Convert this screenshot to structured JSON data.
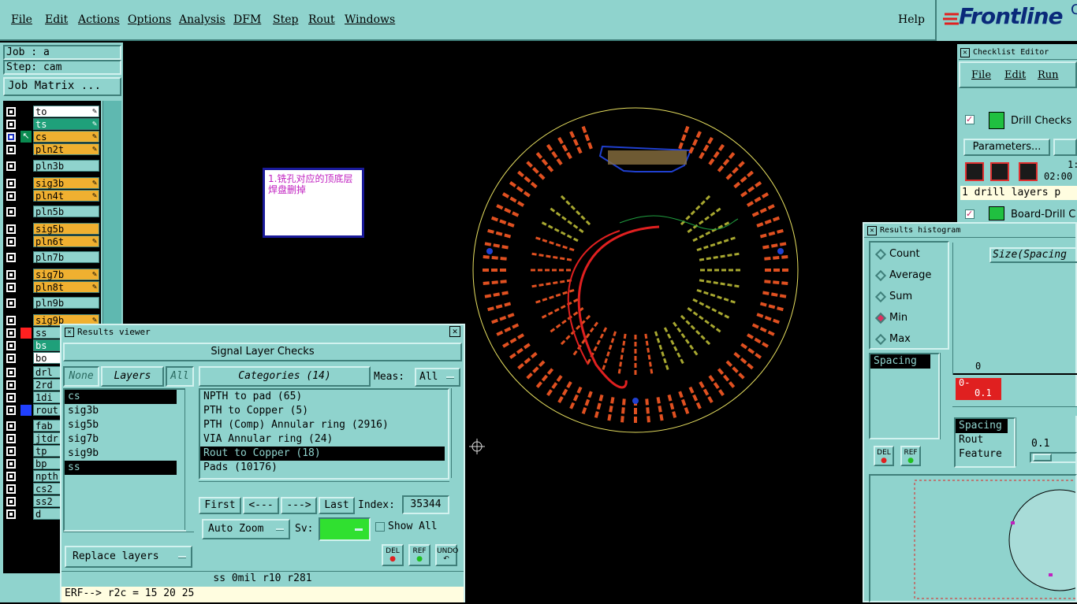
{
  "menubar": {
    "items": [
      "File",
      "Edit",
      "Actions",
      "Options",
      "Analysis",
      "DFM",
      "Step",
      "Rout",
      "Windows"
    ],
    "help": "Help",
    "logo": "Frontline"
  },
  "job": {
    "job_label": "Job : a",
    "step_label": "Step: cam",
    "matrix_button": "Job Matrix ..."
  },
  "layers": [
    {
      "name": "to",
      "color": "#ffffff"
    },
    {
      "name": "ts",
      "color": "#1fa07a"
    },
    {
      "name": "cs",
      "color": "#f0b030"
    },
    {
      "name": "pln2t",
      "color": "#f0b030"
    },
    {
      "name": "pln3b",
      "color": "#8fd3cd"
    },
    {
      "name": "sig3b",
      "color": "#f0b030"
    },
    {
      "name": "pln4t",
      "color": "#f0b030"
    },
    {
      "name": "pln5b",
      "color": "#8fd3cd"
    },
    {
      "name": "sig5b",
      "color": "#f0b030"
    },
    {
      "name": "pln6t",
      "color": "#f0b030"
    },
    {
      "name": "pln7b",
      "color": "#8fd3cd"
    },
    {
      "name": "sig7b",
      "color": "#f0b030"
    },
    {
      "name": "pln8t",
      "color": "#f0b030"
    },
    {
      "name": "pln9b",
      "color": "#8fd3cd"
    },
    {
      "name": "sig9b",
      "color": "#f0b030"
    },
    {
      "name": "ss",
      "color": "#8fd3cd"
    },
    {
      "name": "bs",
      "color": "#1fa07a"
    },
    {
      "name": "bo",
      "color": "#ffffff"
    },
    {
      "name": "drl",
      "color": "#8fd3cd"
    },
    {
      "name": "2rd",
      "color": "#8fd3cd"
    },
    {
      "name": "1di",
      "color": "#8fd3cd"
    },
    {
      "name": "rout",
      "color": "#8fd3cd"
    },
    {
      "name": "fab",
      "color": "#8fd3cd"
    },
    {
      "name": "jtdr",
      "color": "#8fd3cd"
    },
    {
      "name": "tp",
      "color": "#8fd3cd"
    },
    {
      "name": "bp",
      "color": "#8fd3cd"
    },
    {
      "name": "npth",
      "color": "#8fd3cd"
    },
    {
      "name": "cs2",
      "color": "#8fd3cd"
    },
    {
      "name": "ss2",
      "color": "#8fd3cd"
    },
    {
      "name": "d",
      "color": "#8fd3cd"
    }
  ],
  "note": {
    "text": "1.铣孔对应的顶底层焊盘删掉"
  },
  "results_viewer": {
    "title": "Results viewer",
    "header": "Signal Layer Checks",
    "none_btn": "None",
    "layers_btn": "Layers",
    "all_btn": "All",
    "categories_btn": "Categories (14)",
    "meas_label": "Meas:",
    "meas_value": "All",
    "layer_items": [
      "cs",
      "sig3b",
      "sig5b",
      "sig7b",
      "sig9b",
      "ss"
    ],
    "category_items": [
      "NPTH to pad (65)",
      "PTH to Copper (5)",
      "PTH (Comp) Annular ring (2916)",
      "VIA Annular ring (24)",
      "Rout to Copper (18)",
      "Pads (10176)"
    ],
    "first_btn": "First",
    "prev_btn": "<---",
    "next_btn": "--->",
    "last_btn": "Last",
    "index_label": "Index:",
    "index_value": "35344",
    "autozoom_btn": "Auto Zoom",
    "sv_label": "Sv:",
    "show_all_label": "Show All",
    "replace_btn": "Replace layers",
    "del_btn": "DEL",
    "ref_btn": "REF",
    "undo_btn": "UNDO",
    "status_line": "ss 0mil  r10  r281",
    "erf_line": "ERF--> r2c = 15 20 25"
  },
  "checklist": {
    "title": "Checklist Editor",
    "menu": [
      "File",
      "Edit",
      "Run"
    ],
    "drill_checks": "Drill Checks",
    "parameters_btn": "Parameters...",
    "time_1": "1:",
    "time_2": "02:00",
    "drill_layers": "1 drill layers p",
    "board_drill": "Board-Drill C"
  },
  "histogram": {
    "title": "Results histogram",
    "options": [
      "Count",
      "Average",
      "Sum",
      "Min",
      "Max"
    ],
    "selected_option": "Min",
    "size_label": "Size(Spacing",
    "list1": [
      "Spacing"
    ],
    "zero_label": "0",
    "bar_label_top": "0-",
    "bar_label_bottom": "0.1",
    "list2": [
      "Spacing",
      "Rout",
      "Feature"
    ],
    "value": "0.1",
    "del_btn": "DEL",
    "ref_btn": "REF"
  },
  "colors": {
    "panel": "#8fd3cd",
    "accent_red": "#e03030",
    "pad_orange": "#e05020",
    "pad_olive": "#a8a830",
    "outline_yellow": "#e8e060",
    "blue": "#2040d0"
  }
}
